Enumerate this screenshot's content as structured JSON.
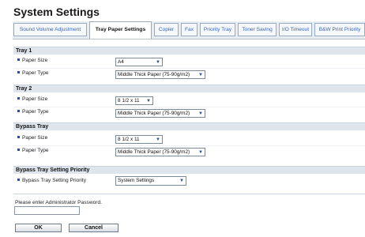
{
  "page": {
    "title": "System Settings"
  },
  "tabs": [
    {
      "label": "Sound Volume Adjustment",
      "active": false
    },
    {
      "label": "Tray Paper Settings",
      "active": true
    },
    {
      "label": "Copier",
      "active": false
    },
    {
      "label": "Fax",
      "active": false
    },
    {
      "label": "Priority Tray",
      "active": false
    },
    {
      "label": "Toner Saving",
      "active": false
    },
    {
      "label": "I/O Timeout",
      "active": false
    },
    {
      "label": "B&W Print Priority",
      "active": false
    }
  ],
  "sections": {
    "tray1": {
      "title": "Tray 1",
      "paper_size_label": "Paper Size",
      "paper_size_value": "A4",
      "paper_type_label": "Paper Type",
      "paper_type_value": "Middle Thick Paper (75-90g/m2)"
    },
    "tray2": {
      "title": "Tray 2",
      "paper_size_label": "Paper Size",
      "paper_size_value": "8 1/2 x 11",
      "paper_type_label": "Paper Type",
      "paper_type_value": "Middle Thick Paper (75-90g/m2)"
    },
    "bypass": {
      "title": "Bypass Tray",
      "paper_size_label": "Paper Size",
      "paper_size_value": "8 1/2 x 11",
      "paper_type_label": "Paper Type",
      "paper_type_value": "Middle Thick Paper (75-90g/m2)"
    },
    "bypass_priority": {
      "title": "Bypass Tray Setting Priority",
      "label": "Bypass Tray Setting Priority",
      "value": "System Settings"
    }
  },
  "password": {
    "label": "Please enter Administrator Password.",
    "value": ""
  },
  "buttons": {
    "ok": "OK",
    "cancel": "Cancel"
  },
  "icons": {
    "dropdown": "chevron-down-icon",
    "bullet": "square-bullet-icon"
  },
  "colors": {
    "tab_text": "#3c66b0",
    "section_bg": "#dfe5ec",
    "bullet": "#3a4e86"
  }
}
